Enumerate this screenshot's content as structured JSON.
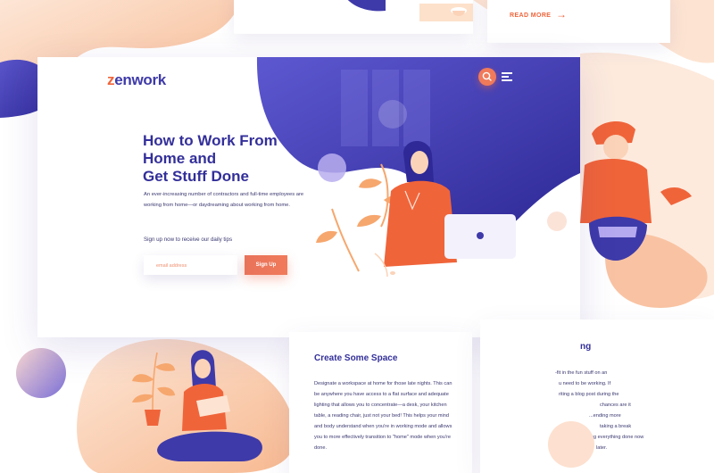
{
  "top_cards": {
    "read_more_label": "READ MORE",
    "read_more_arrow": "→"
  },
  "header": {
    "logo_text": "zenwork",
    "search_icon": "search-icon",
    "menu_icon": "hamburger-menu-icon"
  },
  "hero": {
    "headline_lines": [
      "How to Work From",
      "Home and",
      "Get Stuff Done"
    ],
    "intro": "An ever-increasing number of contractors and full-time employees are working from home—or daydreaming about working from home.",
    "tips_text": "Sign up now to receive our daily tips",
    "email_placeholder": "email address",
    "signup_label": "Sign Up"
  },
  "section_card": {
    "title": "Create Some Space",
    "body": "Designate a workspace at home for those late nights. This can be anywhere you have access to a flat surface and adequate lighting that allows you to concentrate—a desk, your kitchen table, a reading chair, just not your bed! This helps your mind and body understand when you're in working mode and allows you to more effectively transition to \"home\" mode when you're done."
  },
  "right_card": {
    "title_fragment": "ng",
    "lines": [
      "-fit in the fun stuff on an",
      "u need to be working. If",
      "riting a blog post during the",
      "chances are it",
      "...ending more",
      "taking a break",
      "...ing everything done now",
      "later."
    ]
  },
  "colors": {
    "brand_indigo": "#3e3aa9",
    "accent_orange": "#f0643a",
    "peach": "#fbd3b8"
  }
}
